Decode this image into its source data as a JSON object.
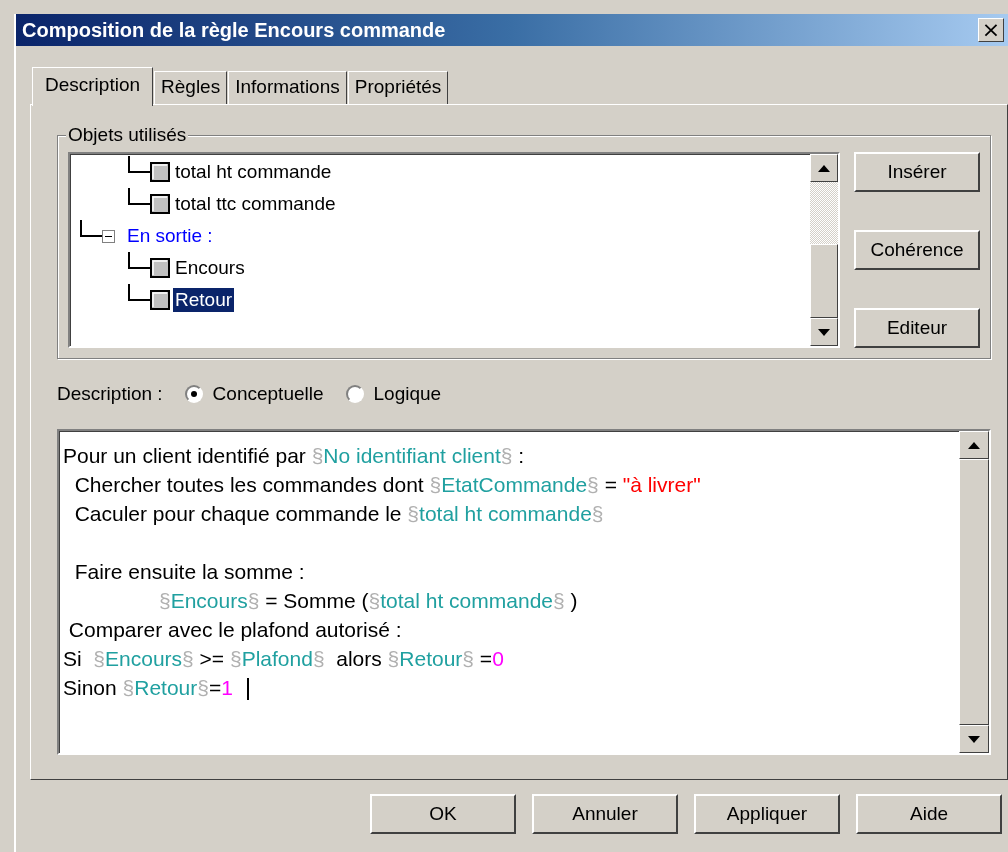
{
  "window": {
    "title": "Composition de la règle Encours commande",
    "close": "×"
  },
  "tabs": [
    {
      "label": "Description",
      "selected": true
    },
    {
      "label": "Règles",
      "selected": false
    },
    {
      "label": "Informations",
      "selected": false
    },
    {
      "label": "Propriétés",
      "selected": false
    }
  ],
  "objects": {
    "legend": "Objets utilisés",
    "tree": [
      {
        "children": [
          {
            "label": "total ht commande",
            "selected": false
          },
          {
            "label": "total ttc commande",
            "selected": false
          }
        ]
      },
      {
        "label": "En sortie :",
        "expanded": true,
        "selected": false,
        "children": [
          {
            "label": "Encours",
            "selected": false
          },
          {
            "label": "Retour",
            "selected": true
          }
        ]
      }
    ],
    "buttons": [
      "Insérer",
      "Cohérence",
      "Editeur"
    ]
  },
  "description": {
    "label": "Description :",
    "options": [
      {
        "label": "Conceptuelle",
        "selected": true
      },
      {
        "label": "Logique",
        "selected": false
      }
    ]
  },
  "editor": {
    "lines": [
      {
        "segments": [
          {
            "kind": "text",
            "text": "Pour un client identifié par "
          },
          {
            "kind": "sigil",
            "text": "§"
          },
          {
            "kind": "var",
            "text": "No identifiant client"
          },
          {
            "kind": "sigil",
            "text": "§"
          },
          {
            "kind": "text",
            "text": " :"
          }
        ]
      },
      {
        "segments": [
          {
            "kind": "text",
            "text": "  Chercher toutes les commandes dont "
          },
          {
            "kind": "sigil",
            "text": "§"
          },
          {
            "kind": "var",
            "text": "EtatCommande"
          },
          {
            "kind": "sigil",
            "text": "§"
          },
          {
            "kind": "text",
            "text": " = "
          },
          {
            "kind": "string",
            "text": "\"à livrer\""
          }
        ]
      },
      {
        "segments": [
          {
            "kind": "text",
            "text": "  Caculer pour chaque commande le "
          },
          {
            "kind": "sigil",
            "text": "§"
          },
          {
            "kind": "var",
            "text": "total ht commande"
          },
          {
            "kind": "sigil",
            "text": "§"
          }
        ]
      },
      {
        "gap_before": true,
        "segments": [
          {
            "kind": "text",
            "text": "  Faire ensuite la somme :"
          }
        ]
      },
      {
        "indented": true,
        "segments": [
          {
            "kind": "sigil",
            "text": "§"
          },
          {
            "kind": "var",
            "text": "Encours"
          },
          {
            "kind": "sigil",
            "text": "§"
          },
          {
            "kind": "text",
            "text": " = Somme ("
          },
          {
            "kind": "sigil",
            "text": "§"
          },
          {
            "kind": "var",
            "text": "total ht commande"
          },
          {
            "kind": "sigil",
            "text": "§"
          },
          {
            "kind": "text",
            "text": " )"
          }
        ]
      },
      {
        "segments": [
          {
            "kind": "text",
            "text": " Comparer avec le plafond autorisé :"
          }
        ]
      },
      {
        "segments": [
          {
            "kind": "text",
            "text": "Si  "
          },
          {
            "kind": "sigil",
            "text": "§"
          },
          {
            "kind": "var",
            "text": "Encours"
          },
          {
            "kind": "sigil",
            "text": "§"
          },
          {
            "kind": "text",
            "text": " >= "
          },
          {
            "kind": "sigil",
            "text": "§"
          },
          {
            "kind": "var",
            "text": "Plafond"
          },
          {
            "kind": "sigil",
            "text": "§"
          },
          {
            "kind": "text",
            "text": "  alors "
          },
          {
            "kind": "sigil",
            "text": "§"
          },
          {
            "kind": "var",
            "text": "Retour"
          },
          {
            "kind": "sigil",
            "text": "§"
          },
          {
            "kind": "text",
            "text": " ="
          },
          {
            "kind": "number",
            "text": "0"
          }
        ]
      },
      {
        "caret": true,
        "segments": [
          {
            "kind": "text",
            "text": "Sinon "
          },
          {
            "kind": "sigil",
            "text": "§"
          },
          {
            "kind": "var",
            "text": "Retour"
          },
          {
            "kind": "sigil",
            "text": "§"
          },
          {
            "kind": "text",
            "text": "="
          },
          {
            "kind": "number",
            "text": "1"
          }
        ]
      }
    ]
  },
  "buttons": [
    "OK",
    "Annuler",
    "Appliquer",
    "Aide"
  ]
}
